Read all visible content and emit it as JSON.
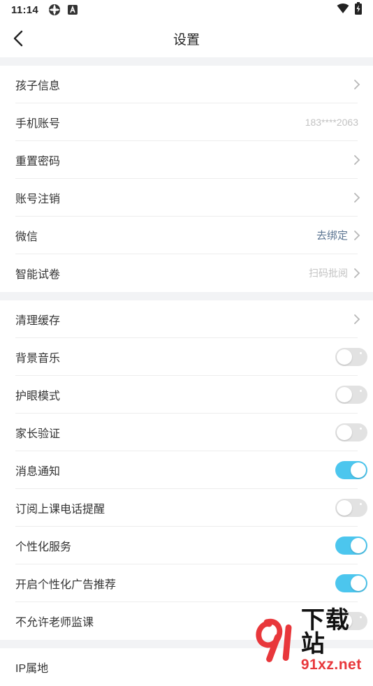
{
  "status_bar": {
    "time": "11:14",
    "icons": [
      "settings-gear-icon",
      "a-notification-icon",
      "wifi-icon",
      "battery-charging-icon"
    ]
  },
  "nav": {
    "title": "设置",
    "back_icon": "chevron-left-icon"
  },
  "group1": [
    {
      "label": "孩子信息",
      "value": "",
      "chevron": true
    },
    {
      "label": "手机账号",
      "value": "183****2063",
      "chevron": false
    },
    {
      "label": "重置密码",
      "value": "",
      "chevron": true
    },
    {
      "label": "账号注销",
      "value": "",
      "chevron": true
    },
    {
      "label": "微信",
      "value": "去绑定",
      "chevron": true
    },
    {
      "label": "智能试卷",
      "value": "扫码批阅",
      "chevron": true
    }
  ],
  "group2": [
    {
      "label": "清理缓存",
      "chevron": true
    },
    {
      "label": "背景音乐",
      "toggle": "off"
    },
    {
      "label": "护眼模式",
      "toggle": "off"
    },
    {
      "label": "家长验证",
      "toggle": "off"
    },
    {
      "label": "消息通知",
      "toggle": "on"
    },
    {
      "label": "订阅上课电话提醒",
      "toggle": "off"
    },
    {
      "label": "个性化服务",
      "toggle": "on"
    },
    {
      "label": "开启个性化广告推荐",
      "toggle": "on"
    },
    {
      "label": "不允许老师监课",
      "toggle": "off"
    }
  ],
  "group3": [
    {
      "label": "IP属地"
    }
  ],
  "watermark": {
    "cn": "下载站",
    "en": "91xz.net"
  },
  "colors": {
    "accent_toggle": "#4cc6ee",
    "toggle_off": "#e2e2e2",
    "section_gap": "#f2f3f5",
    "link_value": "#5c7592",
    "muted_value": "#c3c3c3"
  }
}
